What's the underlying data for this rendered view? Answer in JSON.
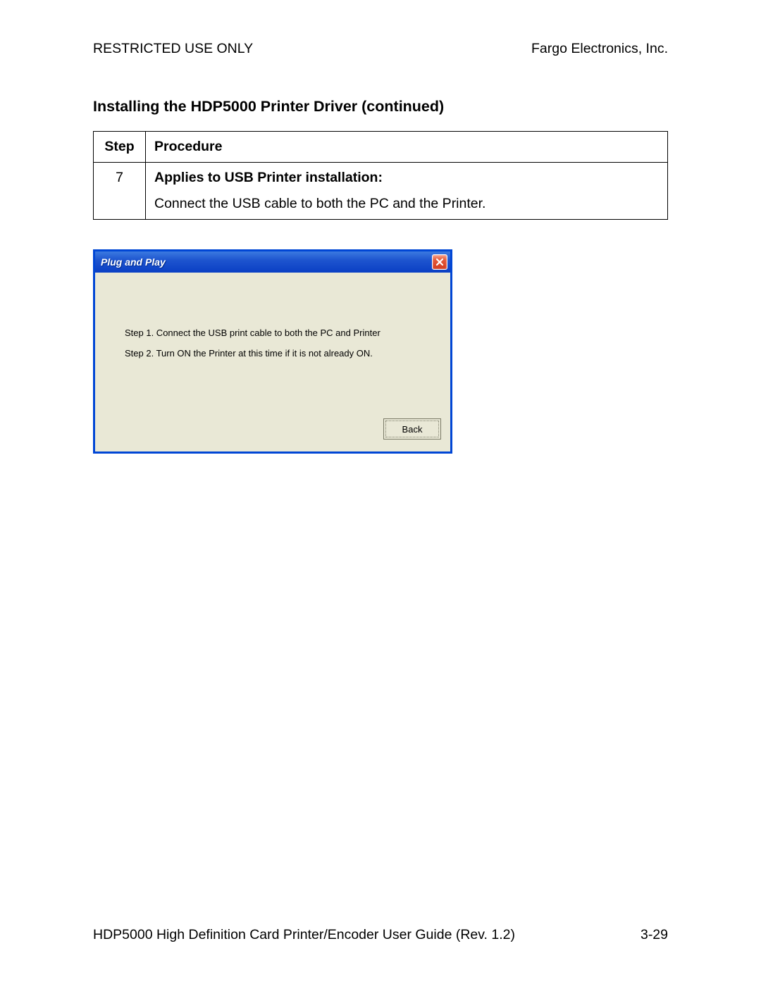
{
  "header": {
    "left": "RESTRICTED USE ONLY",
    "right": "Fargo Electronics, Inc."
  },
  "section_title": "Installing the HDP5000 Printer Driver (continued)",
  "table": {
    "headers": {
      "step": "Step",
      "procedure": "Procedure"
    },
    "rows": [
      {
        "step": "7",
        "title": "Applies to USB Printer installation:",
        "body": "Connect the USB cable to both the PC and the Printer."
      }
    ]
  },
  "dialog": {
    "title": "Plug and Play",
    "steps": [
      "Step 1.  Connect the USB print cable to both the PC and Printer",
      "Step 2.  Turn ON the Printer at this time if it is not already ON."
    ],
    "back_label": "Back"
  },
  "footer": {
    "left": "HDP5000 High Definition Card Printer/Encoder User Guide (Rev. 1.2)",
    "right": "3-29"
  }
}
